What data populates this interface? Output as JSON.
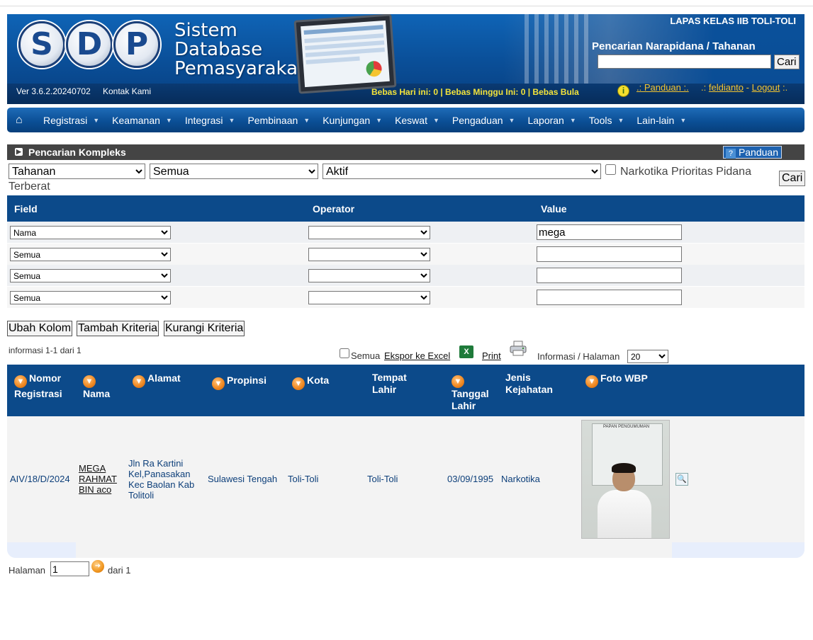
{
  "header": {
    "logo_letters": [
      "S",
      "D",
      "P"
    ],
    "logo_line1": "Sistem",
    "logo_line2": "Database",
    "logo_line3": "Pemasyarakatan",
    "lapas": "LAPAS KELAS IIB TOLI-TOLI",
    "search_title": "Pencarian Narapidana / Tahanan",
    "search_value": "",
    "search_button": "Cari",
    "version": "Ver 3.6.2.20240702",
    "contact": "Kontak Kami",
    "marquee": "Bebas Hari ini: 0 | Bebas Minggu Ini: 0 | Bebas Bula",
    "links": {
      "panduan": ".: Panduan :.",
      "sep1": ".:",
      "user": "feldianto",
      "sep2": "-",
      "logout": "Logout",
      "sep3": ":."
    }
  },
  "nav": {
    "items": [
      "Registrasi",
      "Keamanan",
      "Integrasi",
      "Pembinaan",
      "Kunjungan",
      "Keswat",
      "Pengaduan",
      "Laporan",
      "Tools",
      "Lain-lain"
    ]
  },
  "section": {
    "title": "Pencarian Kompleks",
    "panduan": "Panduan"
  },
  "filters": {
    "jenis": "Tahanan",
    "kategori": "Semua",
    "status": "Aktif",
    "narkotika_label": "Narkotika Prioritas Pidana",
    "narkotika_label_wrap": "Terberat",
    "cari": "Cari"
  },
  "criteria": {
    "headers": {
      "field": "Field",
      "operator": "Operator",
      "value": "Value"
    },
    "rows": [
      {
        "field": "Nama",
        "operator": "",
        "value": "mega"
      },
      {
        "field": "Semua",
        "operator": "",
        "value": ""
      },
      {
        "field": "Semua",
        "operator": "",
        "value": ""
      },
      {
        "field": "Semua",
        "operator": "",
        "value": ""
      }
    ]
  },
  "actions": {
    "ubah_kolom": "Ubah Kolom",
    "tambah_kriteria": "Tambah Kriteria",
    "kurangi_kriteria": "Kurangi Kriteria"
  },
  "results_meta": {
    "info_range": "informasi 1-1 dari 1",
    "semua": "Semua",
    "ekspor": "Ekspor ke Excel",
    "print": "Print",
    "per_page_label": "Informasi / Halaman",
    "per_page": "20"
  },
  "results": {
    "headers": {
      "nomor_line1": "Nomor",
      "nomor_line2": "Registrasi",
      "nama": "Nama",
      "alamat": "Alamat",
      "propinsi": "Propinsi",
      "kota": "Kota",
      "tempat_line1": "Tempat",
      "tempat_line2": "Lahir",
      "tanggal_line1": "Tanggal",
      "tanggal_line2": "Lahir",
      "jenis_line1": "Jenis",
      "jenis_line2": "Kejahatan",
      "foto": "Foto WBP"
    },
    "rows": [
      {
        "nomor": "AIV/18/D/2024",
        "nama_line1": "MEGA",
        "nama_line2": "RAHMAT",
        "nama_line3": "BIN aco",
        "alamat_line1": "Jln Ra Kartini",
        "alamat_line2": "Kel,Panasakan",
        "alamat_line3": "Kec Baolan Kab",
        "alamat_line4": "Tolitoli",
        "propinsi": "Sulawesi Tengah",
        "kota": "Toli-Toli",
        "tempat_lahir": "Toli-Toli",
        "tanggal_lahir": "03/09/1995",
        "jenis_kejahatan": "Narkotika",
        "photo_board": "PAPAN PENGUMUMAN"
      }
    ]
  },
  "pagination": {
    "label": "Halaman",
    "current": "1",
    "of": "dari 1"
  }
}
